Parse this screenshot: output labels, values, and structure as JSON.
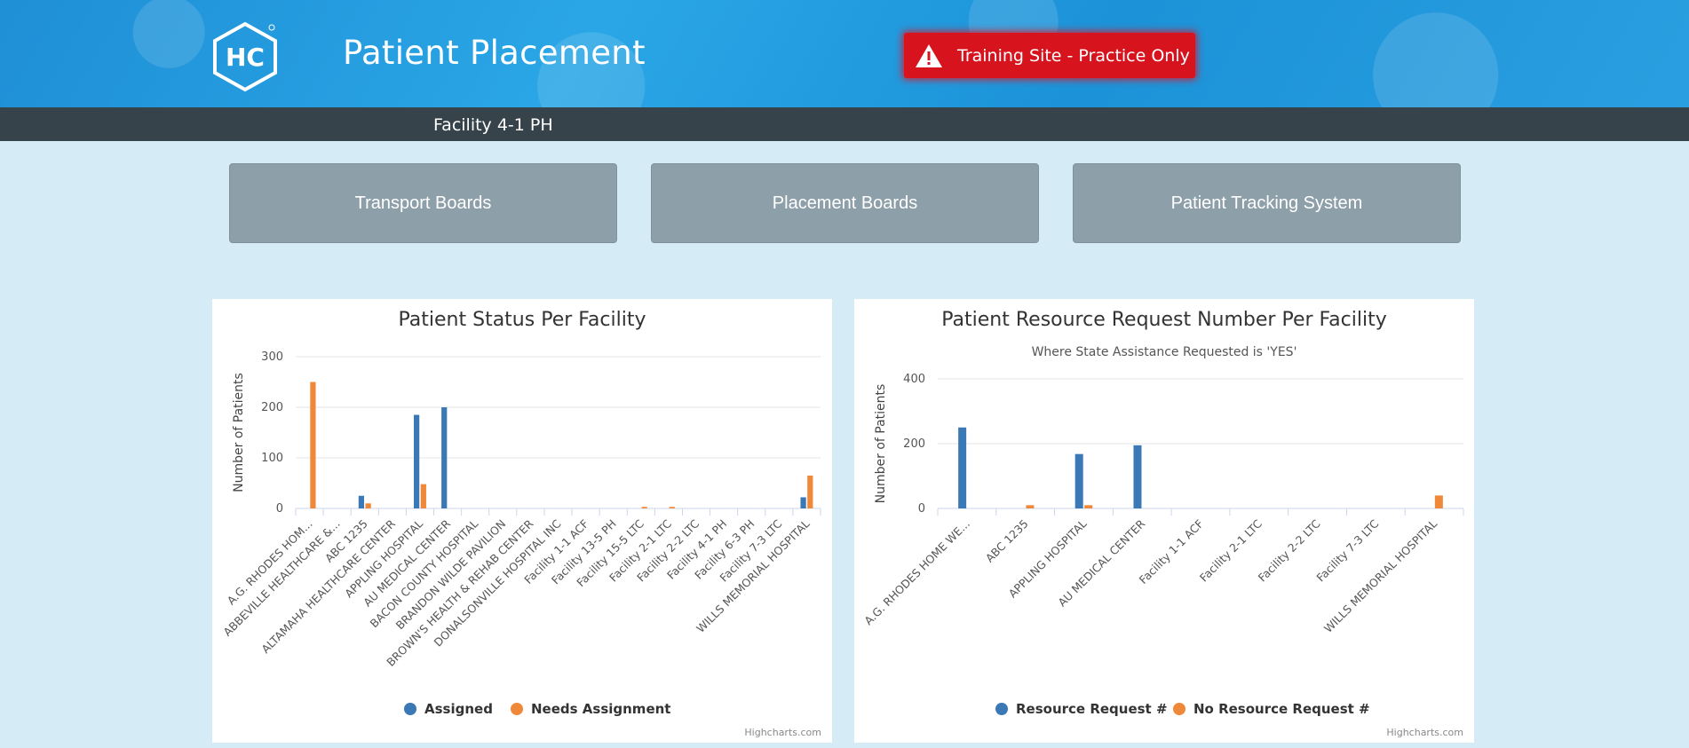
{
  "app": {
    "logo_text": "HC",
    "title": "Patient Placement",
    "training_badge": "Training Site - Practice Only",
    "facility": "Facility 4-1 PH"
  },
  "nav": {
    "transport": "Transport Boards",
    "placement": "Placement Boards",
    "tracking": "Patient Tracking System"
  },
  "colors": {
    "series_blue": "#3b78b6",
    "series_orange": "#f0883a"
  },
  "chart_data": [
    {
      "type": "bar",
      "title": "Patient Status Per Facility",
      "subtitle": "",
      "xlabel": "",
      "ylabel": "Number of Patients",
      "ylim": [
        0,
        300
      ],
      "yticks": [
        0,
        100,
        200,
        300
      ],
      "grid": true,
      "legend": "bottom-center",
      "categories": [
        "A.G. RHODES HOM...",
        "ABBEVILLE HEALTHCARE &...",
        "ABC 1235",
        "ALTAMAHA HEALTHCARE CENTER",
        "APPLING HOSPITAL",
        "AU MEDICAL CENTER",
        "BACON COUNTY HOSPITAL",
        "BRANDON WILDE PAVILION",
        "BROWN'S HEALTH & REHAB CENTER",
        "DONALSONVILLE HOSPITAL INC",
        "Facility 1-1 ACF",
        "Facility 13-5 PH",
        "Facility 15-5 LTC",
        "Facility 2-1 LTC",
        "Facility 2-2 LTC",
        "Facility 4-1 PH",
        "Facility 6-3 PH",
        "Facility 7-3 LTC",
        "WILLS MEMORIAL HOSPITAL"
      ],
      "series": [
        {
          "name": "Assigned",
          "values": [
            0,
            0,
            25,
            0,
            185,
            200,
            0,
            0,
            0,
            0,
            0,
            0,
            0,
            0,
            0,
            0,
            0,
            0,
            22
          ]
        },
        {
          "name": "Needs Assignment",
          "values": [
            250,
            0,
            10,
            0,
            48,
            0,
            0,
            0,
            0,
            0,
            0,
            0,
            3,
            3,
            0,
            0,
            0,
            0,
            65
          ]
        }
      ],
      "credits": "Highcharts.com"
    },
    {
      "type": "bar",
      "title": "Patient Resource Request Number Per Facility",
      "subtitle": "Where State Assistance Requested is 'YES'",
      "xlabel": "",
      "ylabel": "Number of Patients",
      "ylim": [
        0,
        400
      ],
      "yticks": [
        0,
        200,
        400
      ],
      "grid": true,
      "legend": "bottom-center",
      "categories": [
        "A.G. RHODES HOME WE...",
        "ABC 1235",
        "APPLING HOSPITAL",
        "AU MEDICAL CENTER",
        "Facility 1-1 ACF",
        "Facility 2-1 LTC",
        "Facility 2-2 LTC",
        "Facility 7-3 LTC",
        "WILLS MEMORIAL HOSPITAL"
      ],
      "series": [
        {
          "name": "Resource Request #",
          "values": [
            250,
            0,
            168,
            195,
            0,
            0,
            0,
            0,
            0
          ]
        },
        {
          "name": "No Resource Request #",
          "values": [
            0,
            10,
            10,
            0,
            0,
            0,
            0,
            0,
            40
          ]
        }
      ],
      "credits": "Highcharts.com"
    }
  ]
}
